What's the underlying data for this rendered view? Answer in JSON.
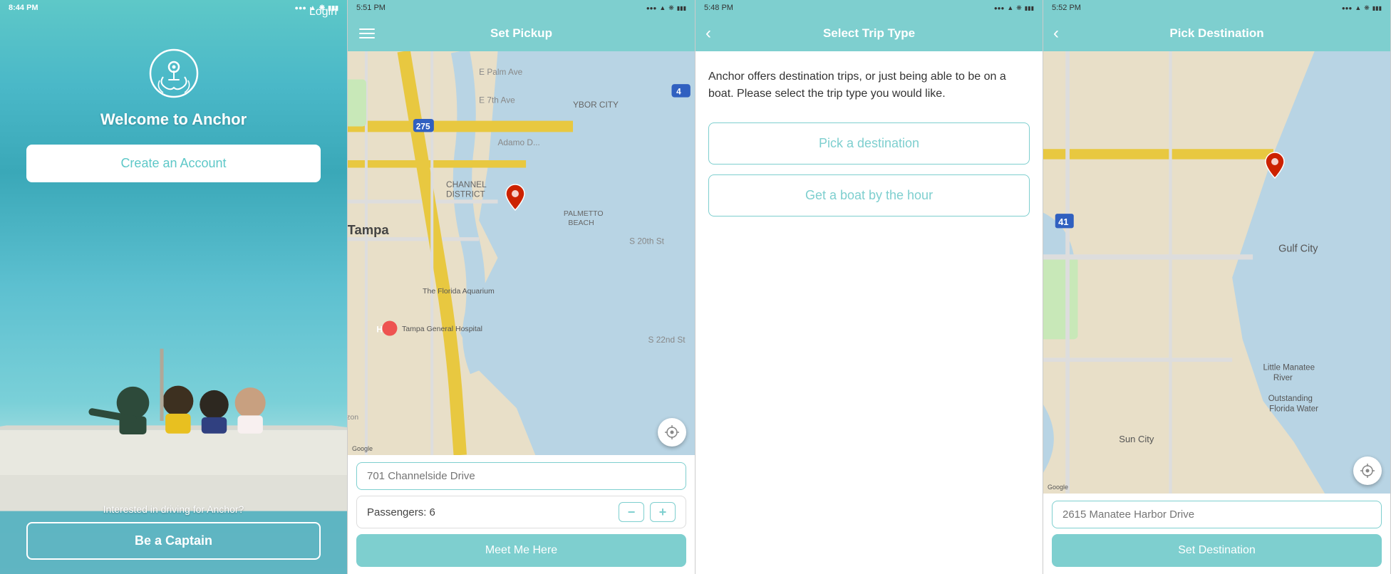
{
  "screens": [
    {
      "id": "welcome",
      "statusBar": {
        "time": "8:44 PM",
        "signal": "●●●",
        "wifi": "wifi",
        "bluetooth": "bt",
        "battery": "battery"
      },
      "logo": "anchor-logo",
      "title": "Welcome to Anchor",
      "createAccountLabel": "Create an Account",
      "driverText": "Interested in driving for Anchor?",
      "captainLabel": "Be a Captain",
      "loginLabel": "Login"
    },
    {
      "id": "set-pickup",
      "statusBar": {
        "time": "5:51 PM",
        "signal": "●●●",
        "wifi": "wifi",
        "bluetooth": "bt",
        "battery": "battery"
      },
      "headerTitle": "Set Pickup",
      "addressPlaceholder": "701 Channelside Drive",
      "passengersLabel": "Passengers: 6",
      "meetMeLabel": "Meet Me Here",
      "locationBtnLabel": "current-location",
      "menuIcon": "hamburger-menu"
    },
    {
      "id": "select-trip",
      "statusBar": {
        "time": "5:48 PM",
        "signal": "●●●",
        "wifi": "wifi",
        "bluetooth": "bt",
        "battery": "battery"
      },
      "headerTitle": "Select Trip Type",
      "description": "Anchor offers destination trips, or just being able to be on a boat. Please select the trip type you would like.",
      "option1Label": "Pick a destination",
      "option2Label": "Get a boat by the hour",
      "backIcon": "back-arrow"
    },
    {
      "id": "pick-destination",
      "statusBar": {
        "time": "5:52 PM",
        "signal": "●●●",
        "wifi": "wifi",
        "bluetooth": "bt",
        "battery": "battery"
      },
      "headerTitle": "Pick Destination",
      "addressPlaceholder": "2615 Manatee Harbor Drive",
      "setDestLabel": "Set Destination",
      "backIcon": "back-arrow",
      "locationBtnLabel": "current-location"
    }
  ],
  "colors": {
    "teal": "#7ecfcf",
    "tealDark": "#5ec8c8",
    "white": "#ffffff",
    "textDark": "#333333",
    "pinRed": "#cc2200"
  }
}
